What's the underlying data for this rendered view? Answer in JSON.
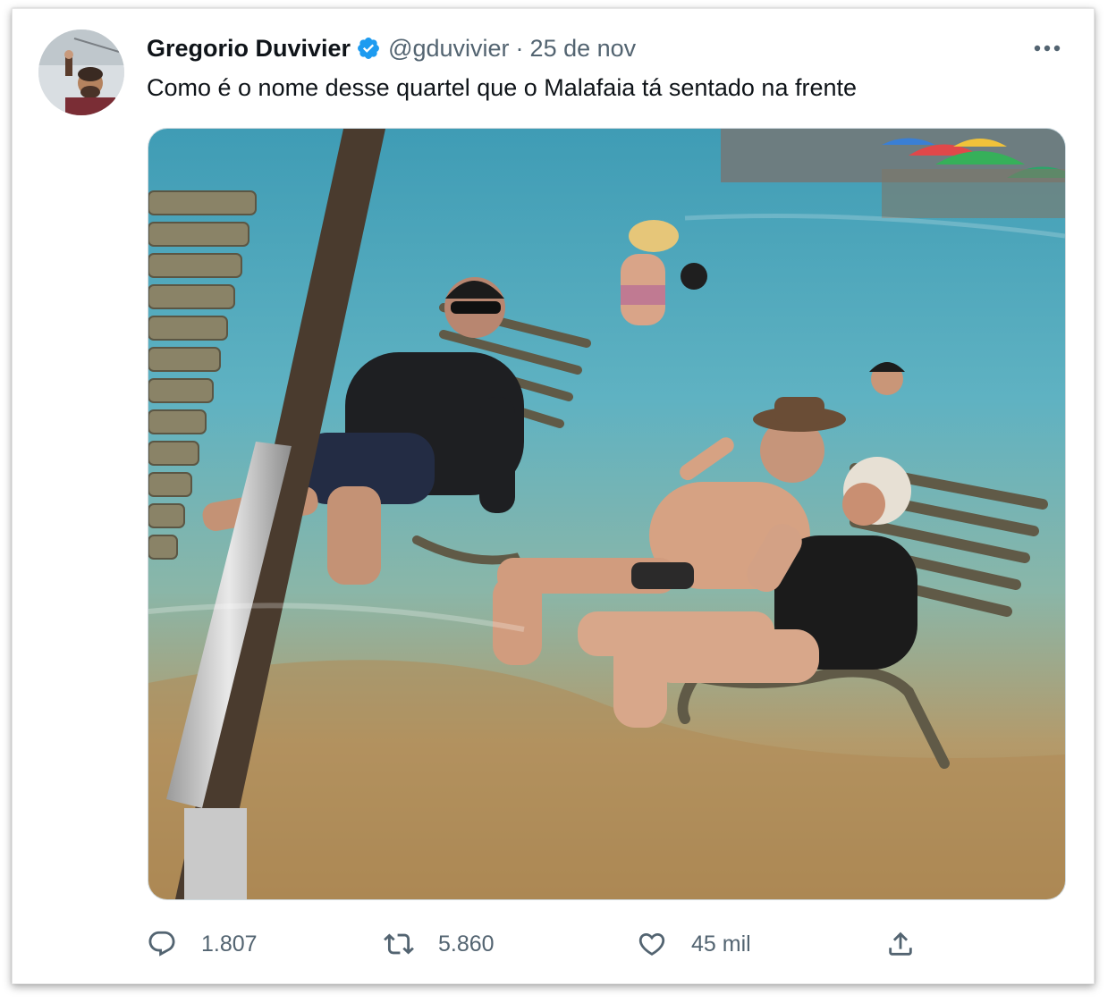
{
  "tweet": {
    "author": {
      "display_name": "Gregorio Duvivier",
      "handle": "@gduvivier",
      "verified": true,
      "avatar_icon": "avatar-photo"
    },
    "separator": "·",
    "date": "25 de nov",
    "text": "Como é o nome desse quartel que o Malafaia tá sentado na frente",
    "media": {
      "type": "photo",
      "icon": "beach-photo"
    },
    "actions": {
      "reply": {
        "icon": "reply-icon",
        "count": "1.807"
      },
      "retweet": {
        "icon": "retweet-icon",
        "count": "5.860"
      },
      "like": {
        "icon": "heart-icon",
        "count": "45 mil"
      },
      "share": {
        "icon": "share-icon"
      }
    },
    "menu_icon": "more-icon"
  },
  "colors": {
    "text_primary": "#0f1419",
    "text_secondary": "#536471",
    "verified_blue": "#1d9bf0",
    "border": "#cfd9de"
  }
}
